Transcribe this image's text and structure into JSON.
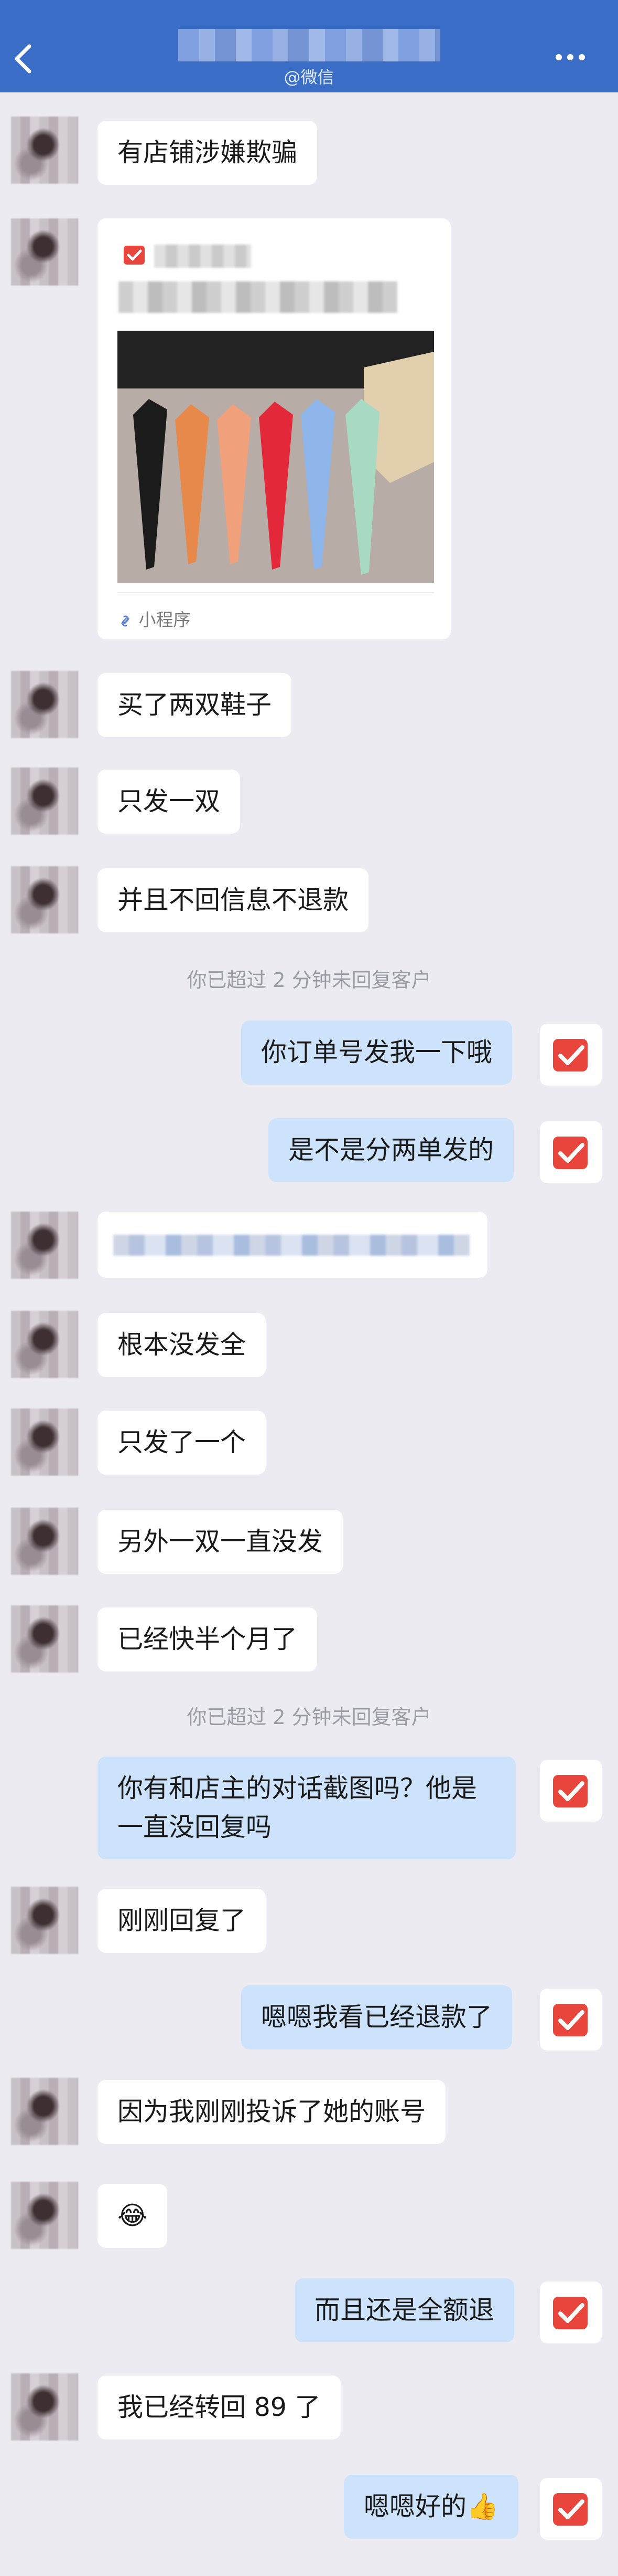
{
  "header": {
    "subtitle": "@微信",
    "more": "more-icon"
  },
  "colors": {
    "topbar": "#3a6ec6",
    "bubble_right": "#cce3fb",
    "brand_red": "#e8453c"
  },
  "card": {
    "mini_program_label": "小程序"
  },
  "messages": [
    {
      "text": "有店铺涉嫌欺骗"
    },
    {
      "text": "买了两双鞋子"
    },
    {
      "text": "只发一双"
    },
    {
      "text": "并且不回信息不退款"
    },
    {
      "text": "你订单号发我一下哦"
    },
    {
      "text": "是不是分两单发的"
    },
    {
      "text": "根本没发全"
    },
    {
      "text": "只发了一个"
    },
    {
      "text": "另外一双一直没发"
    },
    {
      "text": "已经快半个月了"
    },
    {
      "text": "你有和店主的对话截图吗？他是一直没回复吗"
    },
    {
      "text": "刚刚回复了"
    },
    {
      "text": "嗯嗯我看已经退款了"
    },
    {
      "text": "因为我刚刚投诉了她的账号"
    },
    {
      "text": "😂"
    },
    {
      "text": "而且还是全额退"
    },
    {
      "text": "我已经转回 89 了"
    },
    {
      "text": "嗯嗯好的👍"
    }
  ],
  "system": [
    "你已超过 2 分钟未回复客户",
    "你已超过 2 分钟未回复客户"
  ]
}
